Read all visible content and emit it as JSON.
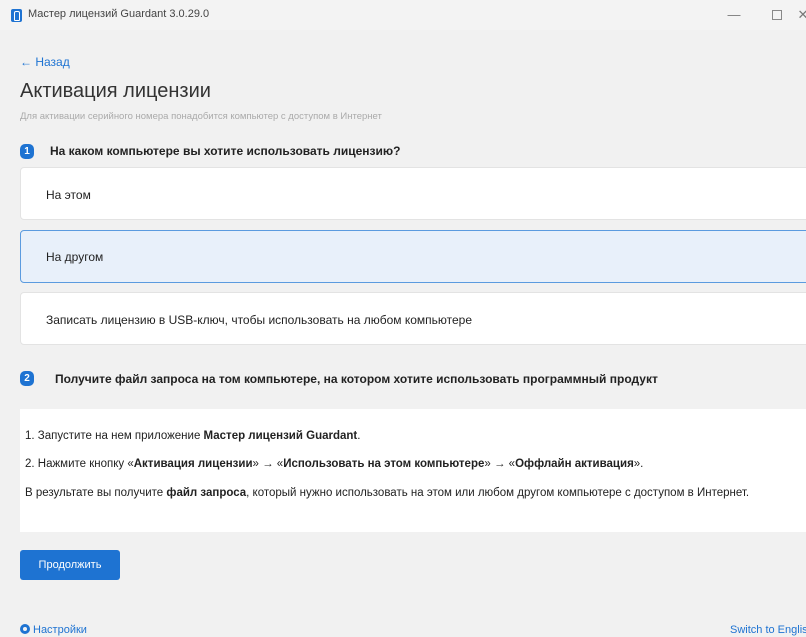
{
  "window": {
    "title": "Мастер лицензий Guardant 3.0.29.0",
    "minimize": "—",
    "close": "✕"
  },
  "nav": {
    "back_label": "← Назад"
  },
  "page": {
    "title": "Активация лицензии",
    "subtitle": "Для активации серийного номера понадобится компьютер с доступом в Интернет"
  },
  "step1": {
    "number": "1",
    "title": "На каком компьютере вы хотите использовать лицензию?",
    "options": [
      {
        "label": "На этом",
        "selected": false
      },
      {
        "label": "На другом",
        "selected": true
      },
      {
        "label": "Записать лицензию в USB-ключ, чтобы использовать на любом компьютере",
        "selected": false
      }
    ]
  },
  "step2": {
    "number": "2",
    "title": "Получите файл запроса на том компьютере, на котором хотите использовать программный продукт",
    "line1_prefix": "1. Запустите на нем приложение ",
    "line1_bold": "Мастер лицензий Guardant",
    "line1_suffix": ".",
    "line2_prefix": "2. Нажмите кнопку «",
    "line2_bold1": "Активация лицензии",
    "line2_sep1": "» → «",
    "line2_bold2": "Использовать на этом компьютере",
    "line2_sep2": "» → «",
    "line2_bold3": "Оффлайн активация",
    "line2_suffix": "».",
    "line3_prefix": "В результате вы получите ",
    "line3_bold": "файл запроса",
    "line3_suffix": ", который нужно использовать на этом или любом другом компьютере с доступом в Интернет."
  },
  "actions": {
    "continue_label": "Продолжить"
  },
  "footer": {
    "settings_label": "Настройки",
    "language_label": "Switch to English"
  },
  "colors": {
    "accent": "#1e73d2",
    "selected_bg": "#e8f0fa",
    "selected_border": "#5b9bdf"
  }
}
